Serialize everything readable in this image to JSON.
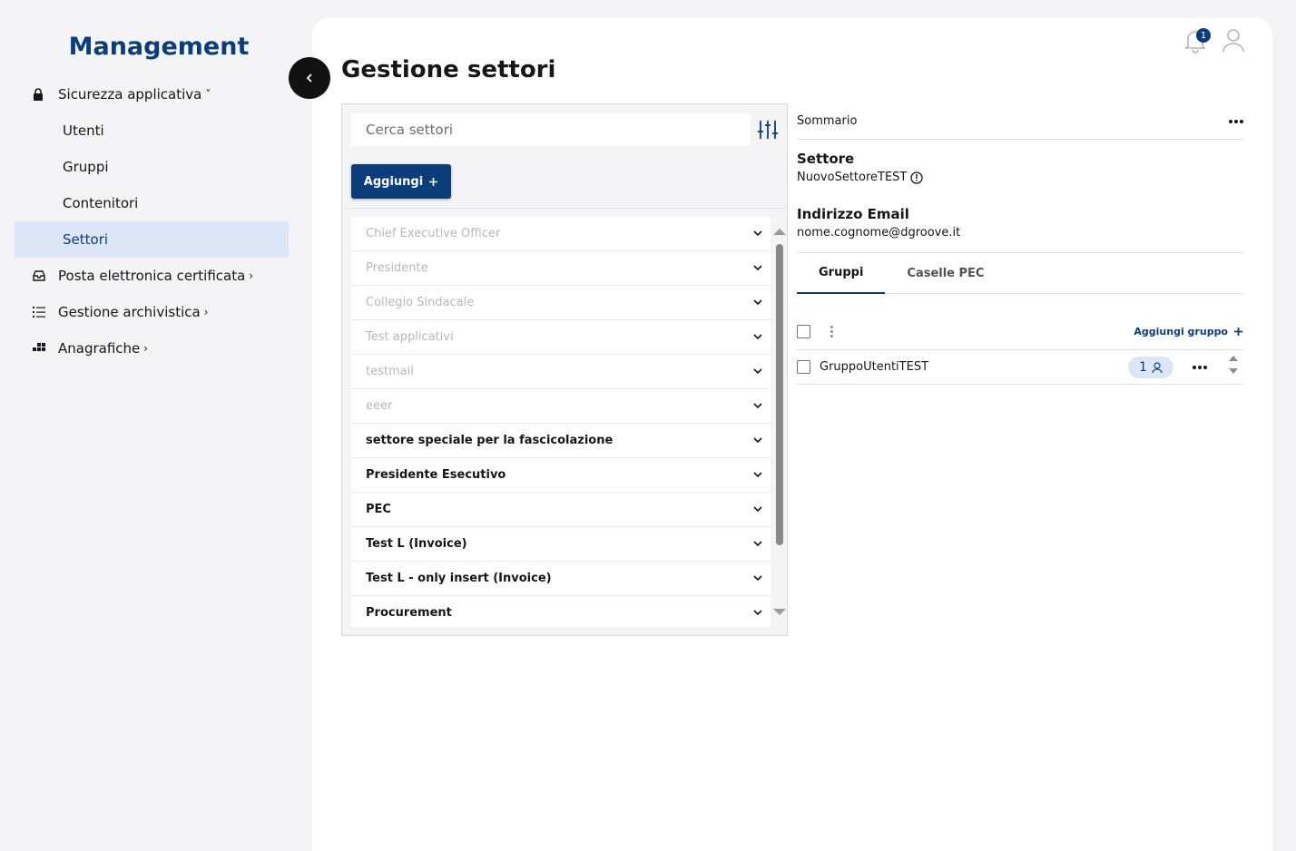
{
  "sidebar": {
    "brand": "Management",
    "items": [
      {
        "label": "Sicurezza applicativa",
        "icon": "lock-icon",
        "chevron": "˅"
      },
      {
        "label": "Utenti"
      },
      {
        "label": "Gruppi"
      },
      {
        "label": "Contenitori"
      },
      {
        "label": "Settori"
      },
      {
        "label": "Posta elettronica certificata",
        "icon": "inbox-icon",
        "chevron": "›"
      },
      {
        "label": "Gestione archivistica",
        "icon": "list-icon",
        "chevron": "›"
      },
      {
        "label": "Anagrafiche",
        "icon": "grid-icon",
        "chevron": "›"
      }
    ]
  },
  "header": {
    "title": "Gestione settori",
    "notification_count": "1"
  },
  "list_panel": {
    "search_placeholder": "Cerca settori",
    "add_label": "Aggiungi",
    "rows": [
      {
        "label": "Chief Executive Officer"
      },
      {
        "label": "Presidente"
      },
      {
        "label": "Collegio Sindacale"
      },
      {
        "label": "Test applicativi"
      },
      {
        "label": "testmail"
      },
      {
        "label": "eeer"
      },
      {
        "label": "settore speciale per la fascicolazione"
      },
      {
        "label": "Presidente Esecutivo"
      },
      {
        "label": "PEC"
      },
      {
        "label": "Test L (Invoice)"
      },
      {
        "label": "Test L - only insert (Invoice)"
      },
      {
        "label": "Procurement"
      }
    ]
  },
  "detail": {
    "summary_label": "Sommario",
    "settore_label": "Settore",
    "settore_value": "NuovoSettoreTEST",
    "email_label": "Indirizzo Email",
    "email_value": "nome.cognome@dgroove.it",
    "tabs": [
      {
        "label": "Gruppi"
      },
      {
        "label": "Caselle PEC"
      }
    ],
    "add_group_label": "Aggiungi gruppo",
    "groups": [
      {
        "name": "GruppoUtentiTEST",
        "members": "1"
      }
    ]
  },
  "colors": {
    "accent": "#0b3d7a",
    "active_bg": "#dde6f7"
  }
}
